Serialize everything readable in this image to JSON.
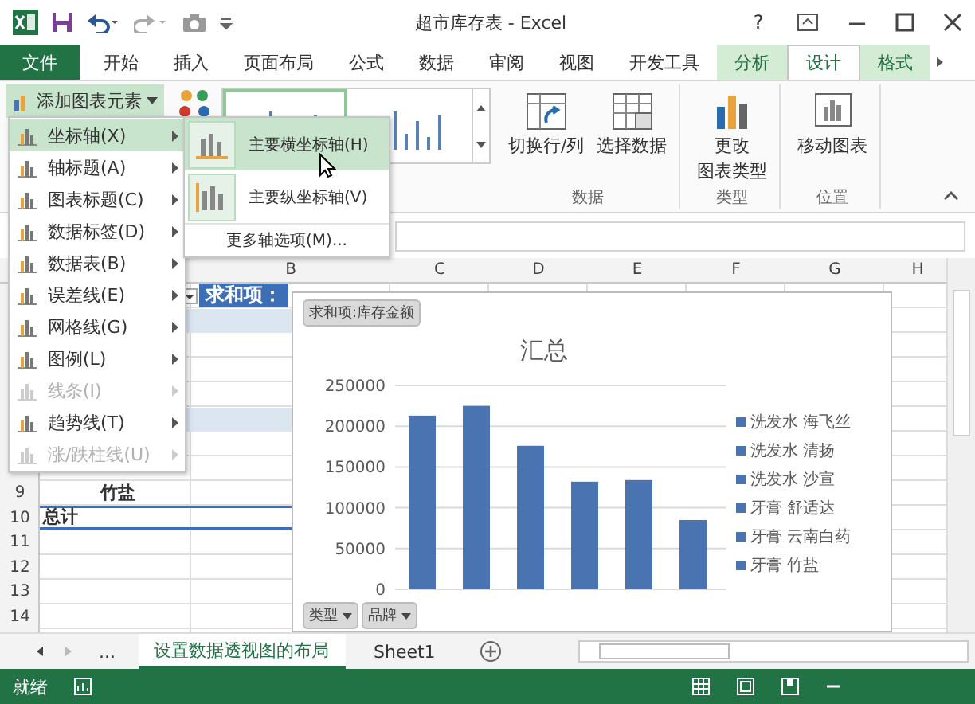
{
  "window": {
    "title": "超市库存表 - Excel",
    "help": "?"
  },
  "tabs": [
    {
      "label": "文件",
      "kind": "file",
      "selected": false
    },
    {
      "label": "开始",
      "kind": "normal",
      "selected": false
    },
    {
      "label": "插入",
      "kind": "normal",
      "selected": false
    },
    {
      "label": "页面布局",
      "kind": "normal",
      "selected": false
    },
    {
      "label": "公式",
      "kind": "normal",
      "selected": false
    },
    {
      "label": "数据",
      "kind": "normal",
      "selected": false
    },
    {
      "label": "审阅",
      "kind": "normal",
      "selected": false
    },
    {
      "label": "视图",
      "kind": "normal",
      "selected": false
    },
    {
      "label": "开发工具",
      "kind": "normal",
      "selected": false
    },
    {
      "label": "分析",
      "kind": "contextual",
      "selected": false
    },
    {
      "label": "设计",
      "kind": "contextual",
      "selected": true
    },
    {
      "label": "格式",
      "kind": "contextual",
      "selected": false
    }
  ],
  "ribbon": {
    "add_element": {
      "label": "添加图表元素",
      "expanded": true
    },
    "styles": [
      {
        "selected": true
      },
      {
        "selected": false
      }
    ],
    "groups": [
      {
        "label": "数据",
        "buttons": [
          {
            "kind": "switch",
            "lines": [
              "切换行/列"
            ]
          },
          {
            "kind": "select",
            "lines": [
              "选择数据"
            ]
          }
        ]
      },
      {
        "label": "类型",
        "buttons": [
          {
            "kind": "change",
            "lines": [
              "更改",
              "图表类型"
            ]
          }
        ]
      },
      {
        "label": "位置",
        "buttons": [
          {
            "kind": "move",
            "lines": [
              "移动图表"
            ]
          }
        ]
      }
    ]
  },
  "menu": {
    "items": [
      {
        "label": "坐标轴(X)",
        "selected": true,
        "disabled": false
      },
      {
        "label": "轴标题(A)",
        "selected": false,
        "disabled": false
      },
      {
        "label": "图表标题(C)",
        "selected": false,
        "disabled": false
      },
      {
        "label": "数据标签(D)",
        "selected": false,
        "disabled": false
      },
      {
        "label": "数据表(B)",
        "selected": false,
        "disabled": false
      },
      {
        "label": "误差线(E)",
        "selected": false,
        "disabled": false
      },
      {
        "label": "网格线(G)",
        "selected": false,
        "disabled": false
      },
      {
        "label": "图例(L)",
        "selected": false,
        "disabled": false
      },
      {
        "label": "线条(I)",
        "selected": false,
        "disabled": true
      },
      {
        "label": "趋势线(T)",
        "selected": false,
        "disabled": false
      },
      {
        "label": "涨/跌柱线(U)",
        "selected": false,
        "disabled": true
      }
    ]
  },
  "submenu": {
    "items": [
      {
        "label": "主要横坐标轴(H)",
        "kind": "horizontal",
        "selected": true
      },
      {
        "label": "主要纵坐标轴(V)",
        "kind": "vertical",
        "selected": false
      }
    ],
    "more": "更多轴选项(M)..."
  },
  "sheet": {
    "columns": [
      "B",
      "C",
      "D",
      "E",
      "F",
      "G",
      "H"
    ],
    "rows": [
      {
        "banded": false,
        "header": "求和项："
      },
      {
        "banded": true
      },
      {
        "banded": false
      },
      {
        "banded": false
      },
      {
        "banded": false
      },
      {
        "banded": true
      },
      {
        "banded": false
      },
      {
        "banded": false
      },
      {
        "number": "9",
        "label": "竹盐",
        "kind": "item"
      },
      {
        "number": "10",
        "label": "总计",
        "kind": "total"
      },
      {
        "number": "11"
      },
      {
        "number": "12"
      },
      {
        "number": "13"
      },
      {
        "number": "14"
      }
    ]
  },
  "chart": {
    "field_button": "求和项:库存金额",
    "filters": [
      "类型",
      "品牌"
    ],
    "chart_data": {
      "type": "bar",
      "title": "汇总",
      "grid": true,
      "series": [
        {
          "name": "洗发水 海飞丝",
          "color": "#4a73b2",
          "values": [
            213000
          ]
        },
        {
          "name": "洗发水 清扬",
          "color": "#4a73b2",
          "values": [
            225000
          ]
        },
        {
          "name": "洗发水 沙宣",
          "color": "#4a73b2",
          "values": [
            176000
          ]
        },
        {
          "name": "牙膏 舒适达",
          "color": "#4a73b2",
          "values": [
            132000
          ]
        },
        {
          "name": "牙膏 云南白药",
          "color": "#4a73b2",
          "values": [
            134000
          ]
        },
        {
          "name": "牙膏 竹盐",
          "color": "#4a73b2",
          "values": [
            85000
          ]
        }
      ],
      "ylim": [
        0,
        250000
      ],
      "yticks": [
        0,
        50000,
        100000,
        150000,
        200000,
        250000
      ]
    }
  },
  "sheet_tabs": {
    "more": "...",
    "tabs": [
      {
        "label": "设置数据透视图的布局",
        "selected": true
      },
      {
        "label": "Sheet1",
        "selected": false
      }
    ]
  },
  "status_bar": {
    "text": "就绪"
  }
}
